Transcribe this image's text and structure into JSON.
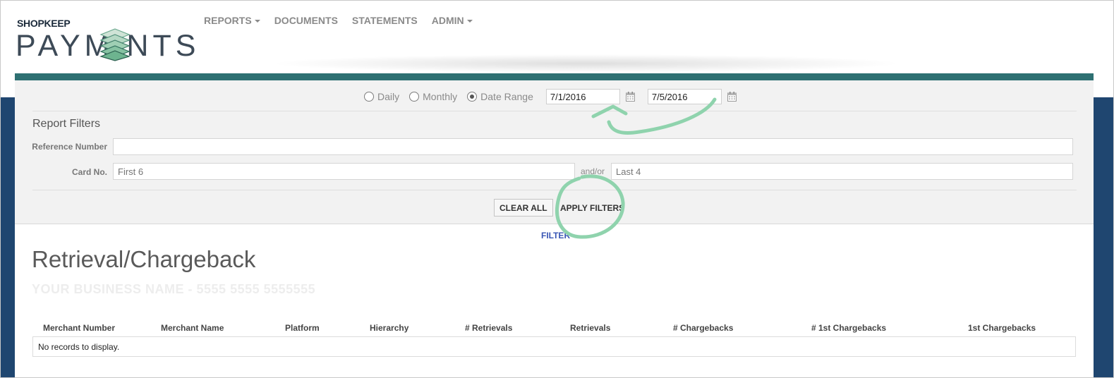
{
  "header": {
    "logo_small": "SHOPKEEP",
    "logo_big": "PAYM NTS",
    "nav": [
      {
        "label": "REPORTS",
        "dropdown": true
      },
      {
        "label": "DOCUMENTS",
        "dropdown": false
      },
      {
        "label": "STATEMENTS",
        "dropdown": false
      },
      {
        "label": "ADMIN",
        "dropdown": true
      }
    ]
  },
  "period": {
    "options": [
      "Daily",
      "Monthly",
      "Date Range"
    ],
    "selected": "Date Range",
    "start_date": "7/1/2016",
    "end_date": "7/5/2016"
  },
  "filters": {
    "title": "Report Filters",
    "reference_label": "Reference Number",
    "reference_value": "",
    "card_label": "Card No.",
    "first6_placeholder": "First 6",
    "andor": "and/or",
    "last4_placeholder": "Last 4",
    "clear_label": "CLEAR ALL",
    "apply_label": "APPLY FILTERS"
  },
  "filter_toggle": "FILTER",
  "report": {
    "title": "Retrieval/Chargeback",
    "business": "YOUR BUSINESS NAME - 5555 5555 5555555",
    "columns": [
      "Merchant Number",
      "Merchant Name",
      "Platform",
      "Hierarchy",
      "# Retrievals",
      "Retrievals",
      "# Chargebacks",
      "# 1st Chargebacks",
      "1st Chargebacks"
    ],
    "empty_message": "No records to display."
  },
  "colors": {
    "teal": "#2e7072",
    "navy": "#1f4670",
    "annotation": "#8fd3ad"
  }
}
